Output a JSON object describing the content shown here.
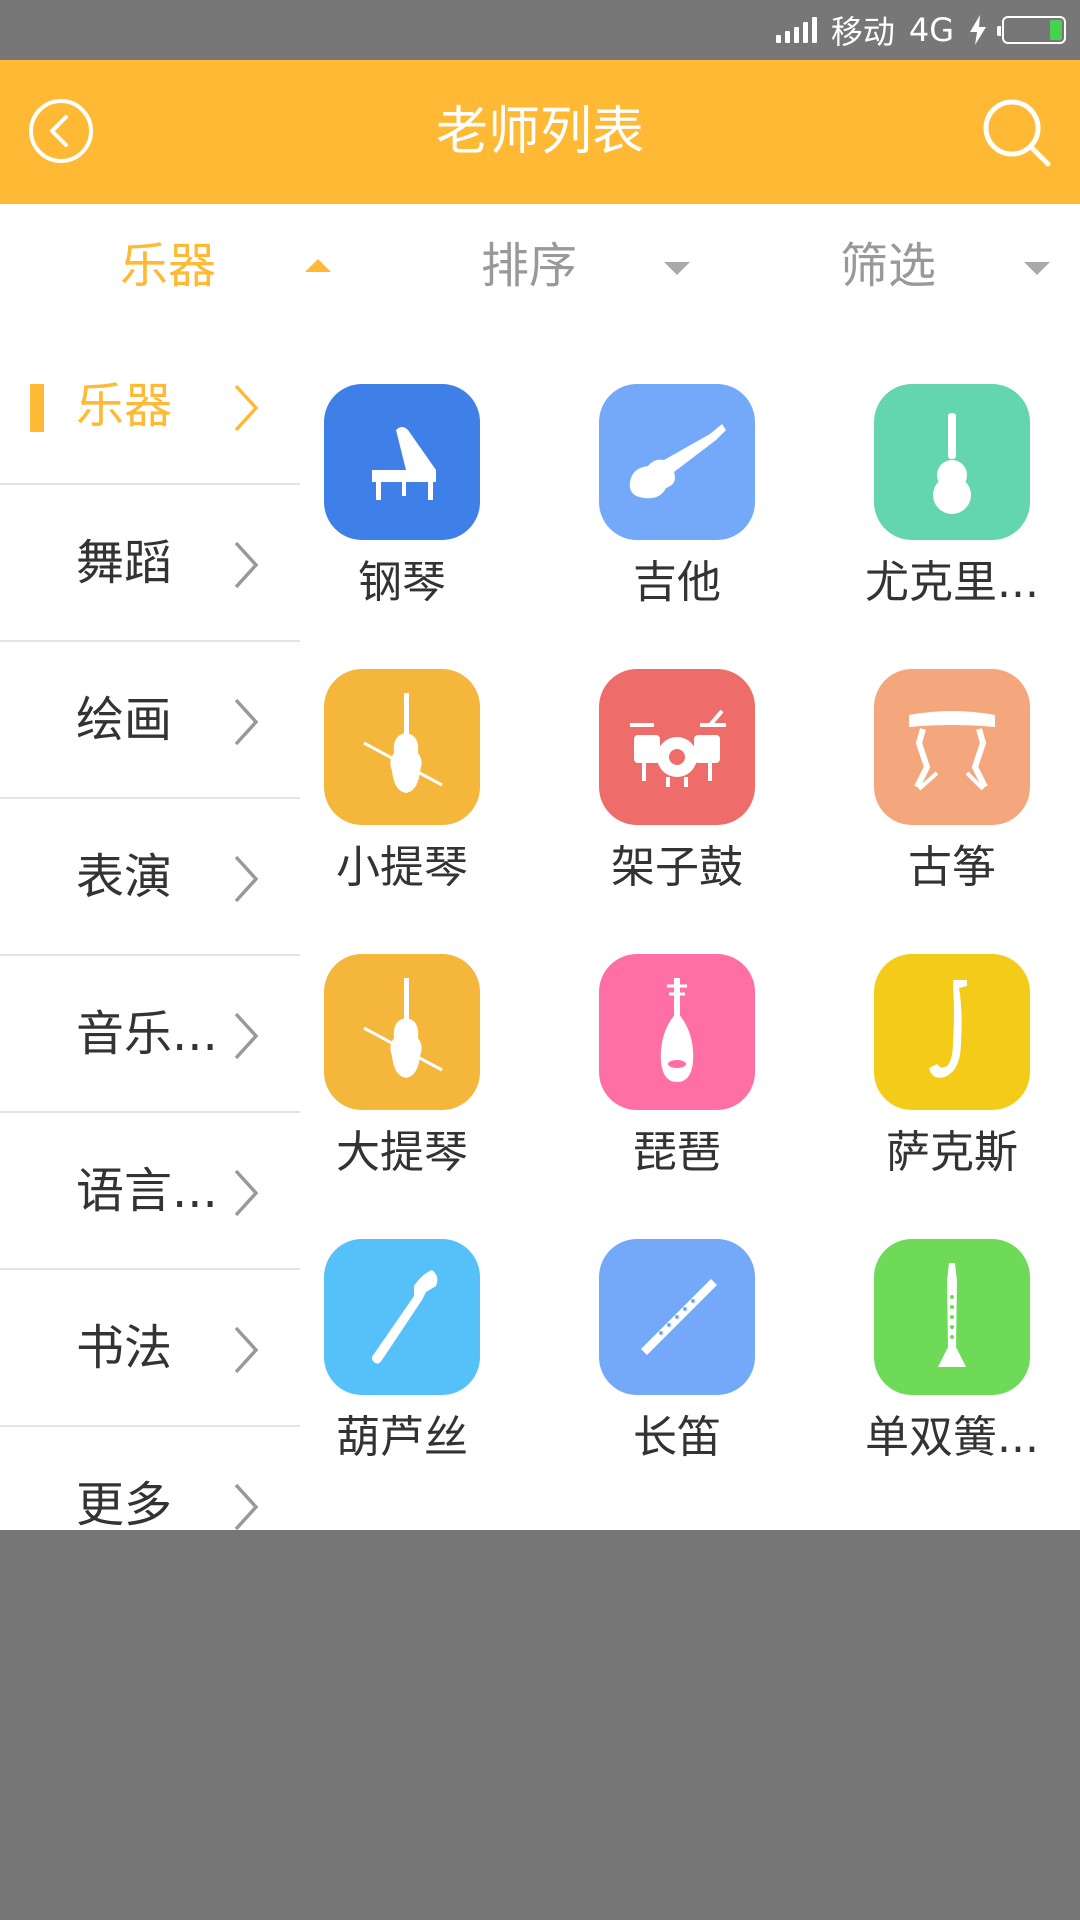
{
  "status_bar": {
    "carrier": "移动",
    "network": "4G"
  },
  "header": {
    "title": "老师列表"
  },
  "filter_tabs": [
    {
      "label": "乐器",
      "active": true
    },
    {
      "label": "排序",
      "active": false
    },
    {
      "label": "筛选",
      "active": false
    }
  ],
  "sidebar": [
    {
      "label": "乐器",
      "active": true
    },
    {
      "label": "舞蹈"
    },
    {
      "label": "绘画"
    },
    {
      "label": "表演"
    },
    {
      "label": "音乐..."
    },
    {
      "label": "语言..."
    },
    {
      "label": "书法"
    },
    {
      "label": "更多"
    }
  ],
  "instruments": [
    {
      "name": "钢琴",
      "icon": "piano-icon",
      "color": "#3F7FE8"
    },
    {
      "name": "吉他",
      "icon": "electric-guitar-icon",
      "color": "#74A9FA"
    },
    {
      "name": "尤克里...",
      "icon": "ukulele-icon",
      "color": "#63D6B0"
    },
    {
      "name": "小提琴",
      "icon": "violin-icon",
      "color": "#F4B63B"
    },
    {
      "name": "架子鼓",
      "icon": "drum-kit-icon",
      "color": "#EE6D6B"
    },
    {
      "name": "古筝",
      "icon": "guzheng-icon",
      "color": "#F4A77C"
    },
    {
      "name": "大提琴",
      "icon": "cello-icon",
      "color": "#F4B63B"
    },
    {
      "name": "琵琶",
      "icon": "pipa-icon",
      "color": "#FF6FA3"
    },
    {
      "name": "萨克斯",
      "icon": "saxophone-icon",
      "color": "#F5CB1A"
    },
    {
      "name": "葫芦丝",
      "icon": "hulusi-icon",
      "color": "#56C1F8"
    },
    {
      "name": "长笛",
      "icon": "flute-icon",
      "color": "#74A9FA"
    },
    {
      "name": "单双簧...",
      "icon": "clarinet-icon",
      "color": "#6FDA58"
    }
  ],
  "colors": {
    "accent": "#FFB935",
    "status_bar": "#777777",
    "battery": "#47D14F"
  }
}
